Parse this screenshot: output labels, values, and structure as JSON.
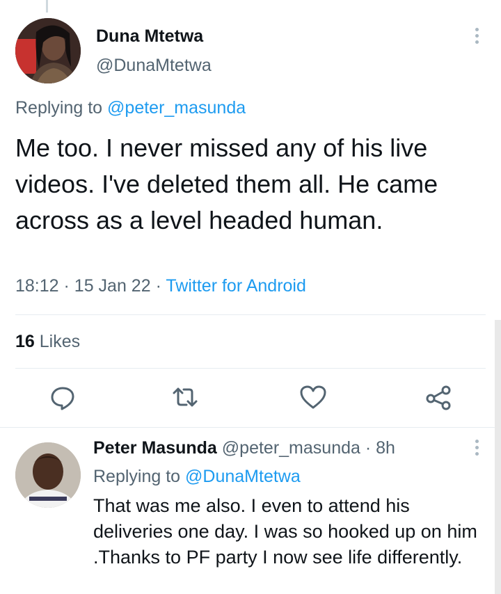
{
  "tweet": {
    "author_name": "Duna Mtetwa",
    "author_handle": "@DunaMtetwa",
    "replying_prefix": "Replying to",
    "replying_to": "@peter_masunda",
    "text": "Me too. I never missed any of his live videos. I've deleted them all. He came across as a level headed human.",
    "time": "18:12",
    "date": "15 Jan 22",
    "source": "Twitter for Android",
    "likes_count": "16",
    "likes_label": "Likes"
  },
  "actions": {
    "reply_icon": "reply-icon",
    "retweet_icon": "retweet-icon",
    "like_icon": "heart-icon",
    "share_icon": "share-icon"
  },
  "reply": {
    "author_name": "Peter Masunda",
    "author_handle": "@peter_masunda",
    "time_ago": "8h",
    "replying_prefix": "Replying to",
    "replying_to": "@DunaMtetwa",
    "text": "That was me also. I even to attend his deliveries one day. I was so hooked up on him .Thanks to PF party I now see life differently."
  },
  "colors": {
    "link": "#1d9bf0",
    "secondary_text": "#536471",
    "primary_text": "#0f1419",
    "icon": "#536471"
  }
}
